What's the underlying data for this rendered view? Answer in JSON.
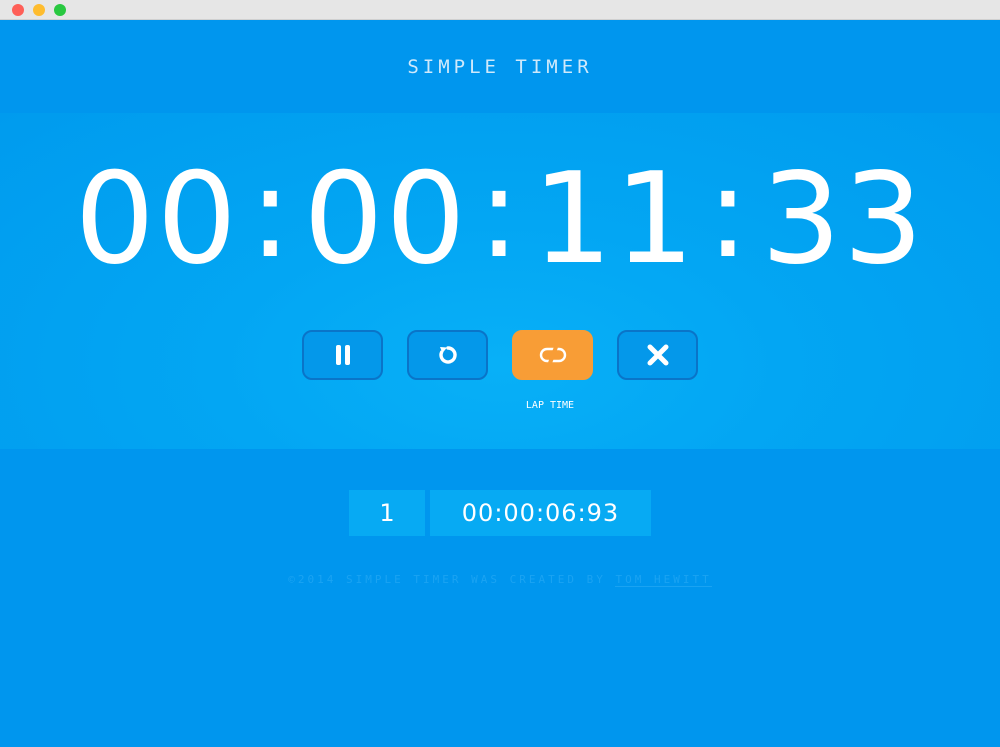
{
  "app": {
    "title": "SIMPLE TIMER"
  },
  "timer": {
    "hours": "00",
    "minutes": "00",
    "seconds": "11",
    "centiseconds": "33",
    "separator": ":"
  },
  "controls": {
    "pause_icon": "pause-icon",
    "reset_icon": "reset-icon",
    "lap_icon": "link-icon",
    "clear_icon": "close-icon",
    "active_label": "LAP TIME"
  },
  "laps": [
    {
      "number": "1",
      "time": "00:00:06:93"
    }
  ],
  "footer": {
    "text": "©2014 SIMPLE TIMER WAS CREATED BY",
    "author": "TOM HEWITT"
  },
  "colors": {
    "background": "#0096ee",
    "accent": "#f89d36",
    "button_border": "#0a74c8",
    "lap_cell": "#07aaf3"
  }
}
